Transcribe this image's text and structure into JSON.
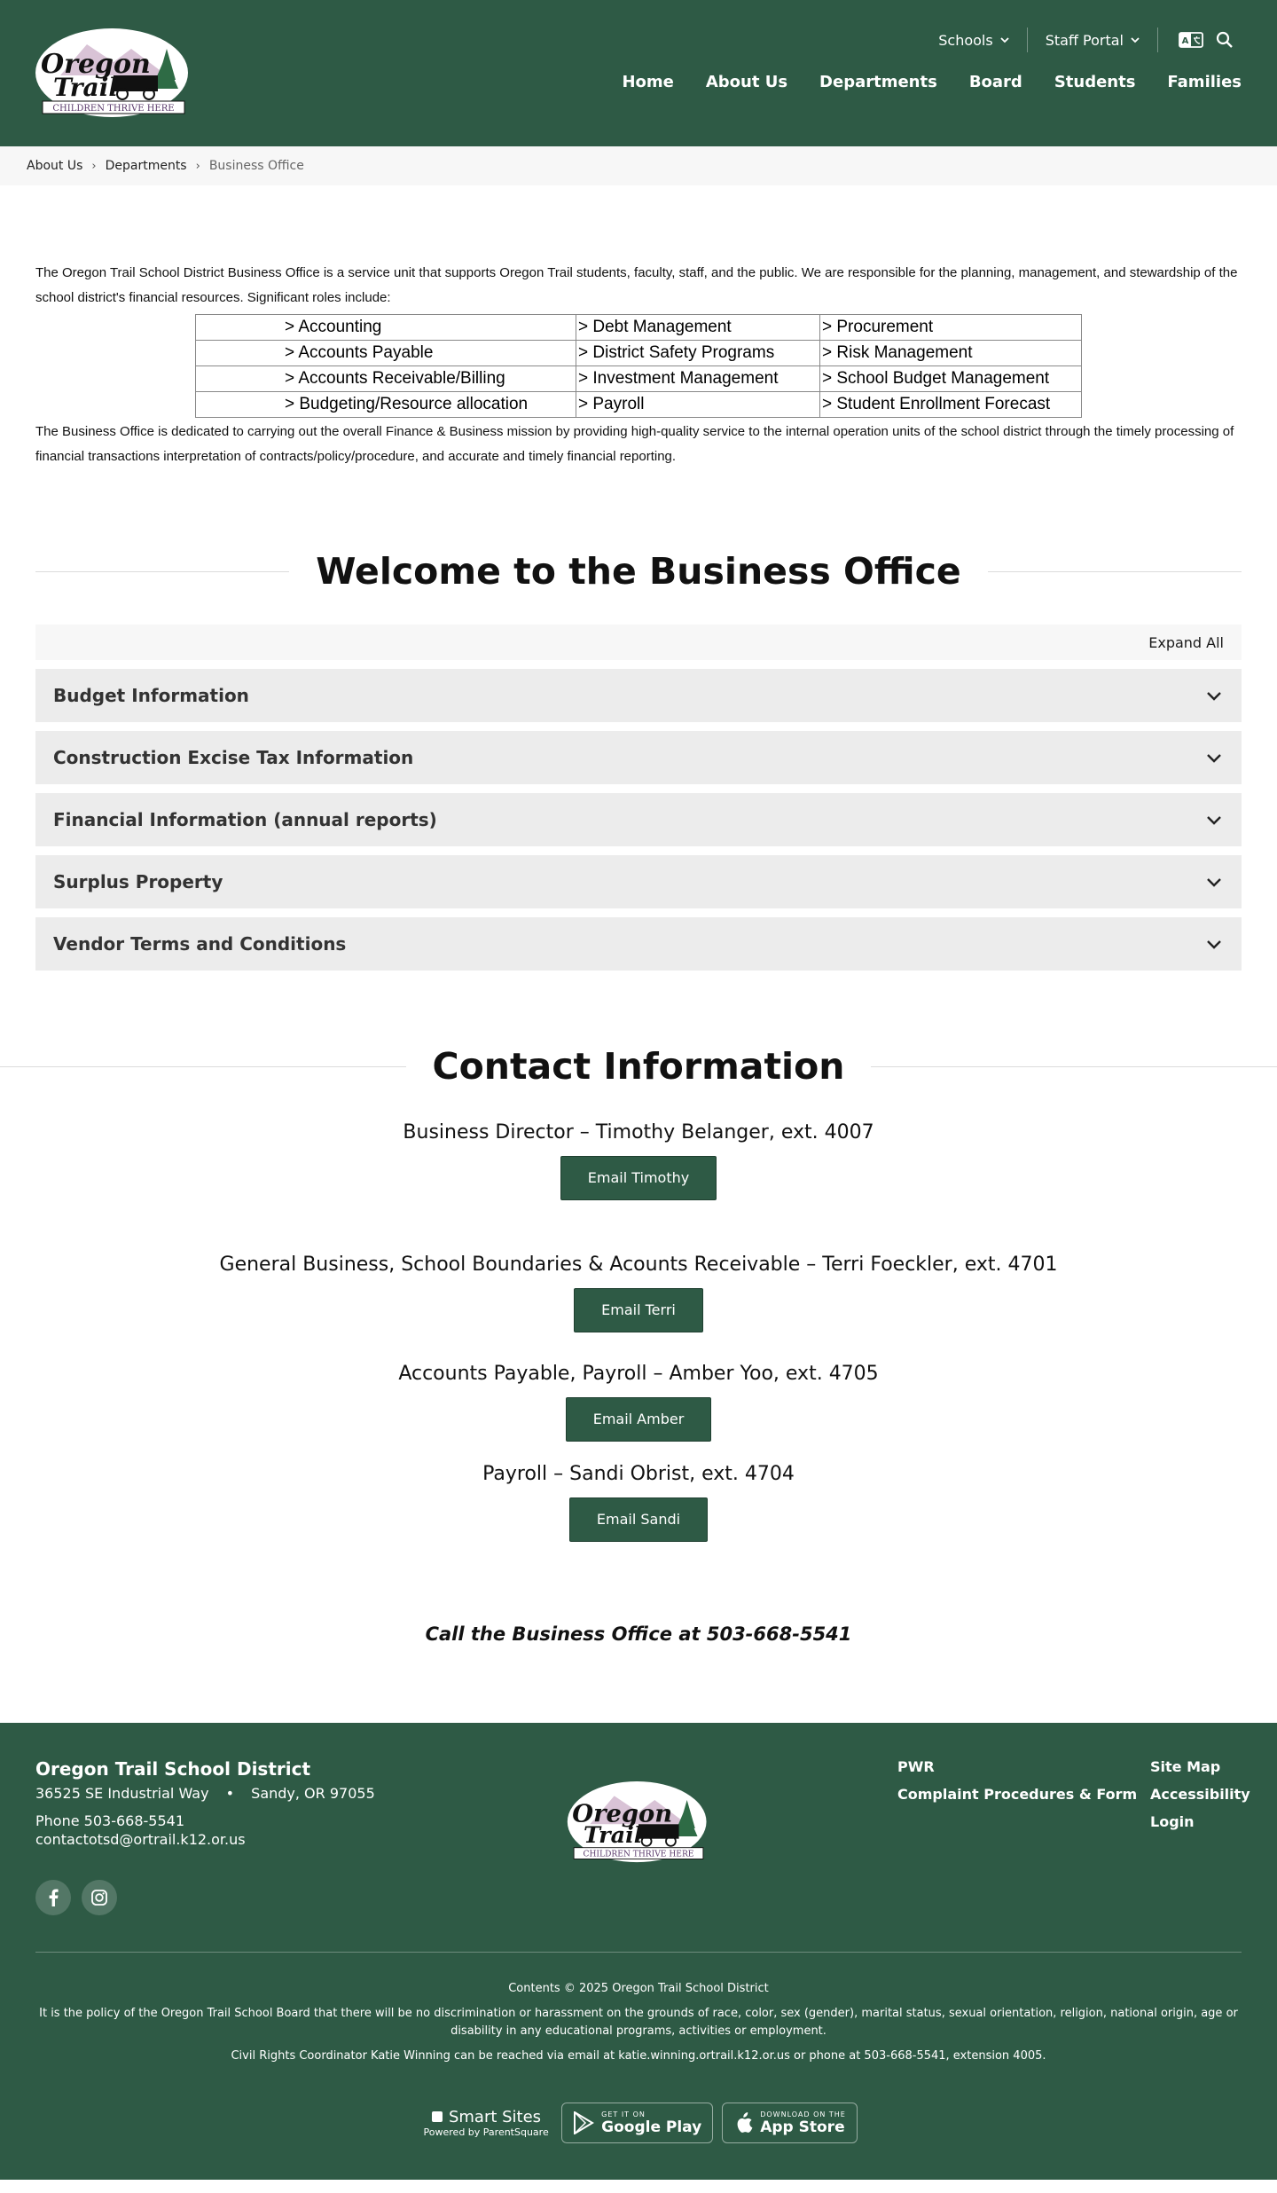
{
  "header": {
    "logo_alt": "Oregon Trail Children Thrive Here",
    "util": [
      "Schools",
      "Staff Portal"
    ],
    "nav": [
      "Home",
      "About Us",
      "Departments",
      "Board",
      "Students",
      "Families"
    ],
    "bg": "#2e5a45"
  },
  "breadcrumb": [
    "About Us",
    "Departments",
    "Business Office"
  ],
  "intro": {
    "p1": "The Oregon Trail School District Business Office is a service unit that supports Oregon Trail students, faculty, staff, and the public. We are responsible for the planning, management, and stewardship of the school district's financial resources. Significant roles include:",
    "roles": [
      [
        "> Accounting",
        "> Debt Management",
        "> Procurement"
      ],
      [
        "> Accounts Payable",
        "> District Safety Programs",
        "> Risk Management"
      ],
      [
        "> Accounts Receivable/Billing",
        "> Investment Management",
        "> School Budget Management"
      ],
      [
        "> Budgeting/Resource allocation",
        "> Payroll",
        "> Student Enrollment Forecast"
      ]
    ],
    "p2": "The Business Office is dedicated to carrying out the overall Finance & Business mission by providing high-quality service to the internal operation units of the school district through the timely processing of financial transactions interpretation of contracts/policy/procedure, and accurate and timely financial reporting."
  },
  "welcome": {
    "title": "Welcome to the Business Office",
    "expand_all": "Expand All",
    "items": [
      "Budget Information",
      "Construction Excise Tax Information",
      "Financial Information (annual reports)",
      "Surplus Property",
      "Vendor Terms and Conditions"
    ]
  },
  "contact": {
    "title": "Contact Information",
    "people": [
      {
        "line": "Business Director – Timothy Belanger, ext. 4007",
        "button": "Email Timothy"
      },
      {
        "line": "General Business, School Boundaries & Acounts Receivable – Terri Foeckler, ext. 4701",
        "button": "Email Terri"
      },
      {
        "line": "Accounts Payable, Payroll – Amber Yoo, ext. 4705",
        "button": "Email Amber"
      },
      {
        "line": "Payroll – Sandi Obrist, ext. 4704",
        "button": "Email Sandi"
      }
    ],
    "call": "Call the Business Office at 503-668-5541"
  },
  "footer": {
    "name": "Oregon Trail School District",
    "street": "36525 SE Industrial Way",
    "city": "Sandy, OR 97055",
    "phone": "Phone 503-668-5541",
    "email": "contactotsd@ortrail.k12.or.us",
    "links1": [
      "PWR",
      "Complaint Procedures & Form"
    ],
    "links2": [
      "Site Map",
      "Accessibility",
      "Login"
    ],
    "copyright": "Contents © 2025 Oregon Trail School District",
    "policy": "It is the policy of the Oregon Trail School Board that there will be no discrimination or harassment on the grounds of race, color, sex (gender), marital status, sexual orientation, religion, national origin, age or disability in any educational programs, activities or employment.",
    "civil": "Civil Rights Coordinator Katie Winning can be reached via email at katie.winning.ortrail.k12.or.us or phone at 503-668-5541, extension 4005.",
    "smart_sites": "Smart Sites",
    "powered": "Powered by ParentSquare",
    "gplay_small": "GET IT ON",
    "gplay_big": "Google Play",
    "appstore_small": "DOWNLOAD ON THE",
    "appstore_big": "App Store"
  }
}
